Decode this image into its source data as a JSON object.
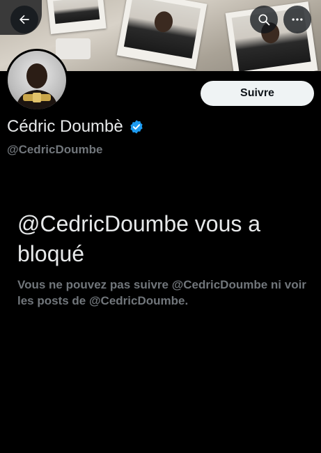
{
  "header": {
    "back_icon": "arrow-left-icon",
    "search_icon": "search-icon",
    "more_icon": "more-horizontal-icon"
  },
  "profile": {
    "display_name": "Cédric Doumbè",
    "handle": "@CedricDoumbe",
    "verified": true,
    "verified_color": "#1d9bf0",
    "follow_label": "Suivre"
  },
  "blocked": {
    "title": "@CedricDoumbe vous a bloqué",
    "description": "Vous ne pouvez pas suivre @CedricDoumbe ni voir les posts de @CedricDoumbe."
  },
  "colors": {
    "background": "#000000",
    "primary_text": "#e7e9ea",
    "secondary_text": "#71767b",
    "follow_button_bg": "#eff3f4"
  }
}
